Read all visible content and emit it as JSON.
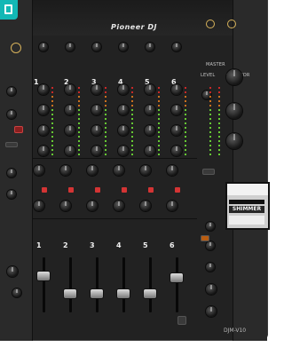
{
  "brand": {
    "logo_text": "Pioneer DJ",
    "model": "DJM-V10"
  },
  "labels": {
    "master": "MASTER",
    "level": "LEVEL",
    "isolator": "ISOLATOR",
    "fx_screen_name": "SHIMMER",
    "fx_screen_value": "1.2"
  },
  "channels": [
    "1",
    "2",
    "3",
    "4",
    "5",
    "6"
  ],
  "colors": {
    "panel": "#222222",
    "led_amber": "#ff8a1e",
    "led_green": "#7cff3a",
    "led_red": "#ff2a2a",
    "accent_red": "#d43434",
    "app_icon": "#13b8b5"
  }
}
